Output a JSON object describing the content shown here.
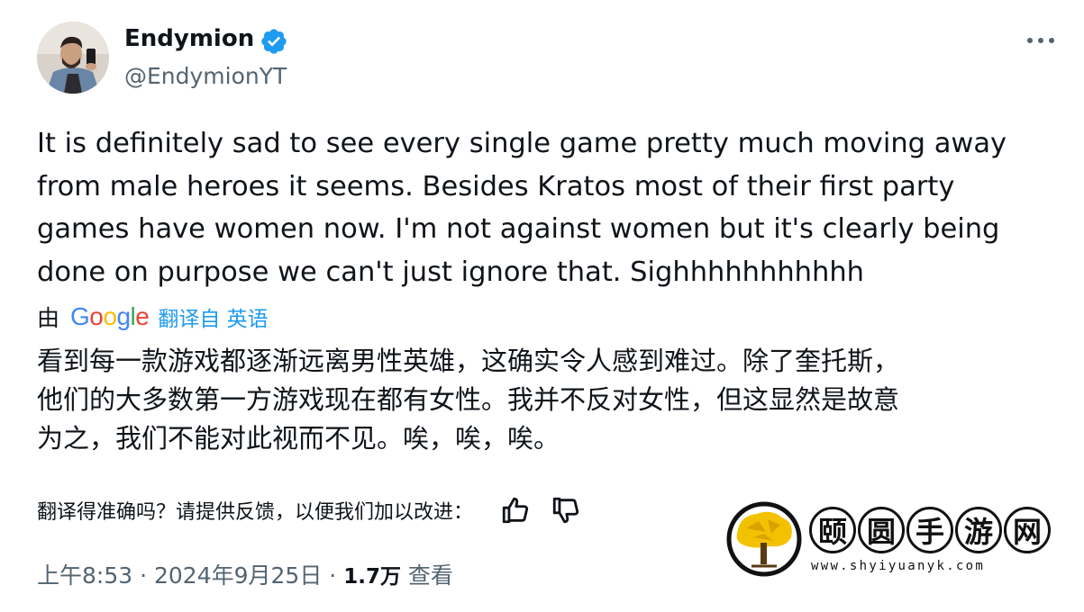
{
  "author": {
    "display_name": "Endymion",
    "handle": "@EndymionYT",
    "verified": true
  },
  "icons": {
    "verified": "verified-badge-icon",
    "more": "more-options-icon",
    "thumbs_up": "thumbs-up-icon",
    "thumbs_down": "thumbs-down-icon"
  },
  "tweet": {
    "lines": [
      "It is definitely sad to see every single game pretty much moving away",
      "from male heroes it seems. Besides Kratos most of their first party",
      "games have women now. I'm not against women but it's clearly being",
      "done on purpose we can't just ignore that. Sighhhhhhhhhhh"
    ]
  },
  "translation": {
    "prefix": "由",
    "provider": "Google",
    "link_text": "翻译自 英语",
    "lines": [
      "看到每一款游戏都逐渐远离男性英雄，这确实令人感到难过。除了奎托斯，",
      "他们的大多数第一方游戏现在都有女性。我并不反对女性，但这显然是故意",
      "为之，我们不能对此视而不见。唉，唉，唉。"
    ],
    "feedback_prompt": "翻译得准确吗？请提供反馈，以便我们加以改进："
  },
  "meta": {
    "time": "上午8:53",
    "separator": "·",
    "date": "2024年9月25日",
    "views_count": "1.7万",
    "views_label": "查看"
  },
  "watermark": {
    "chars": [
      "颐",
      "圆",
      "手",
      "游",
      "网"
    ],
    "url": "www.shyiyuanyk.com"
  },
  "colors": {
    "text": "#0f1419",
    "secondary": "#536471",
    "link": "#1d9bf0",
    "google_blue": "#4285F4",
    "google_red": "#EA4335",
    "google_yellow": "#FBBC05",
    "google_green": "#34A853",
    "watermark_gold": "#F2C200"
  }
}
